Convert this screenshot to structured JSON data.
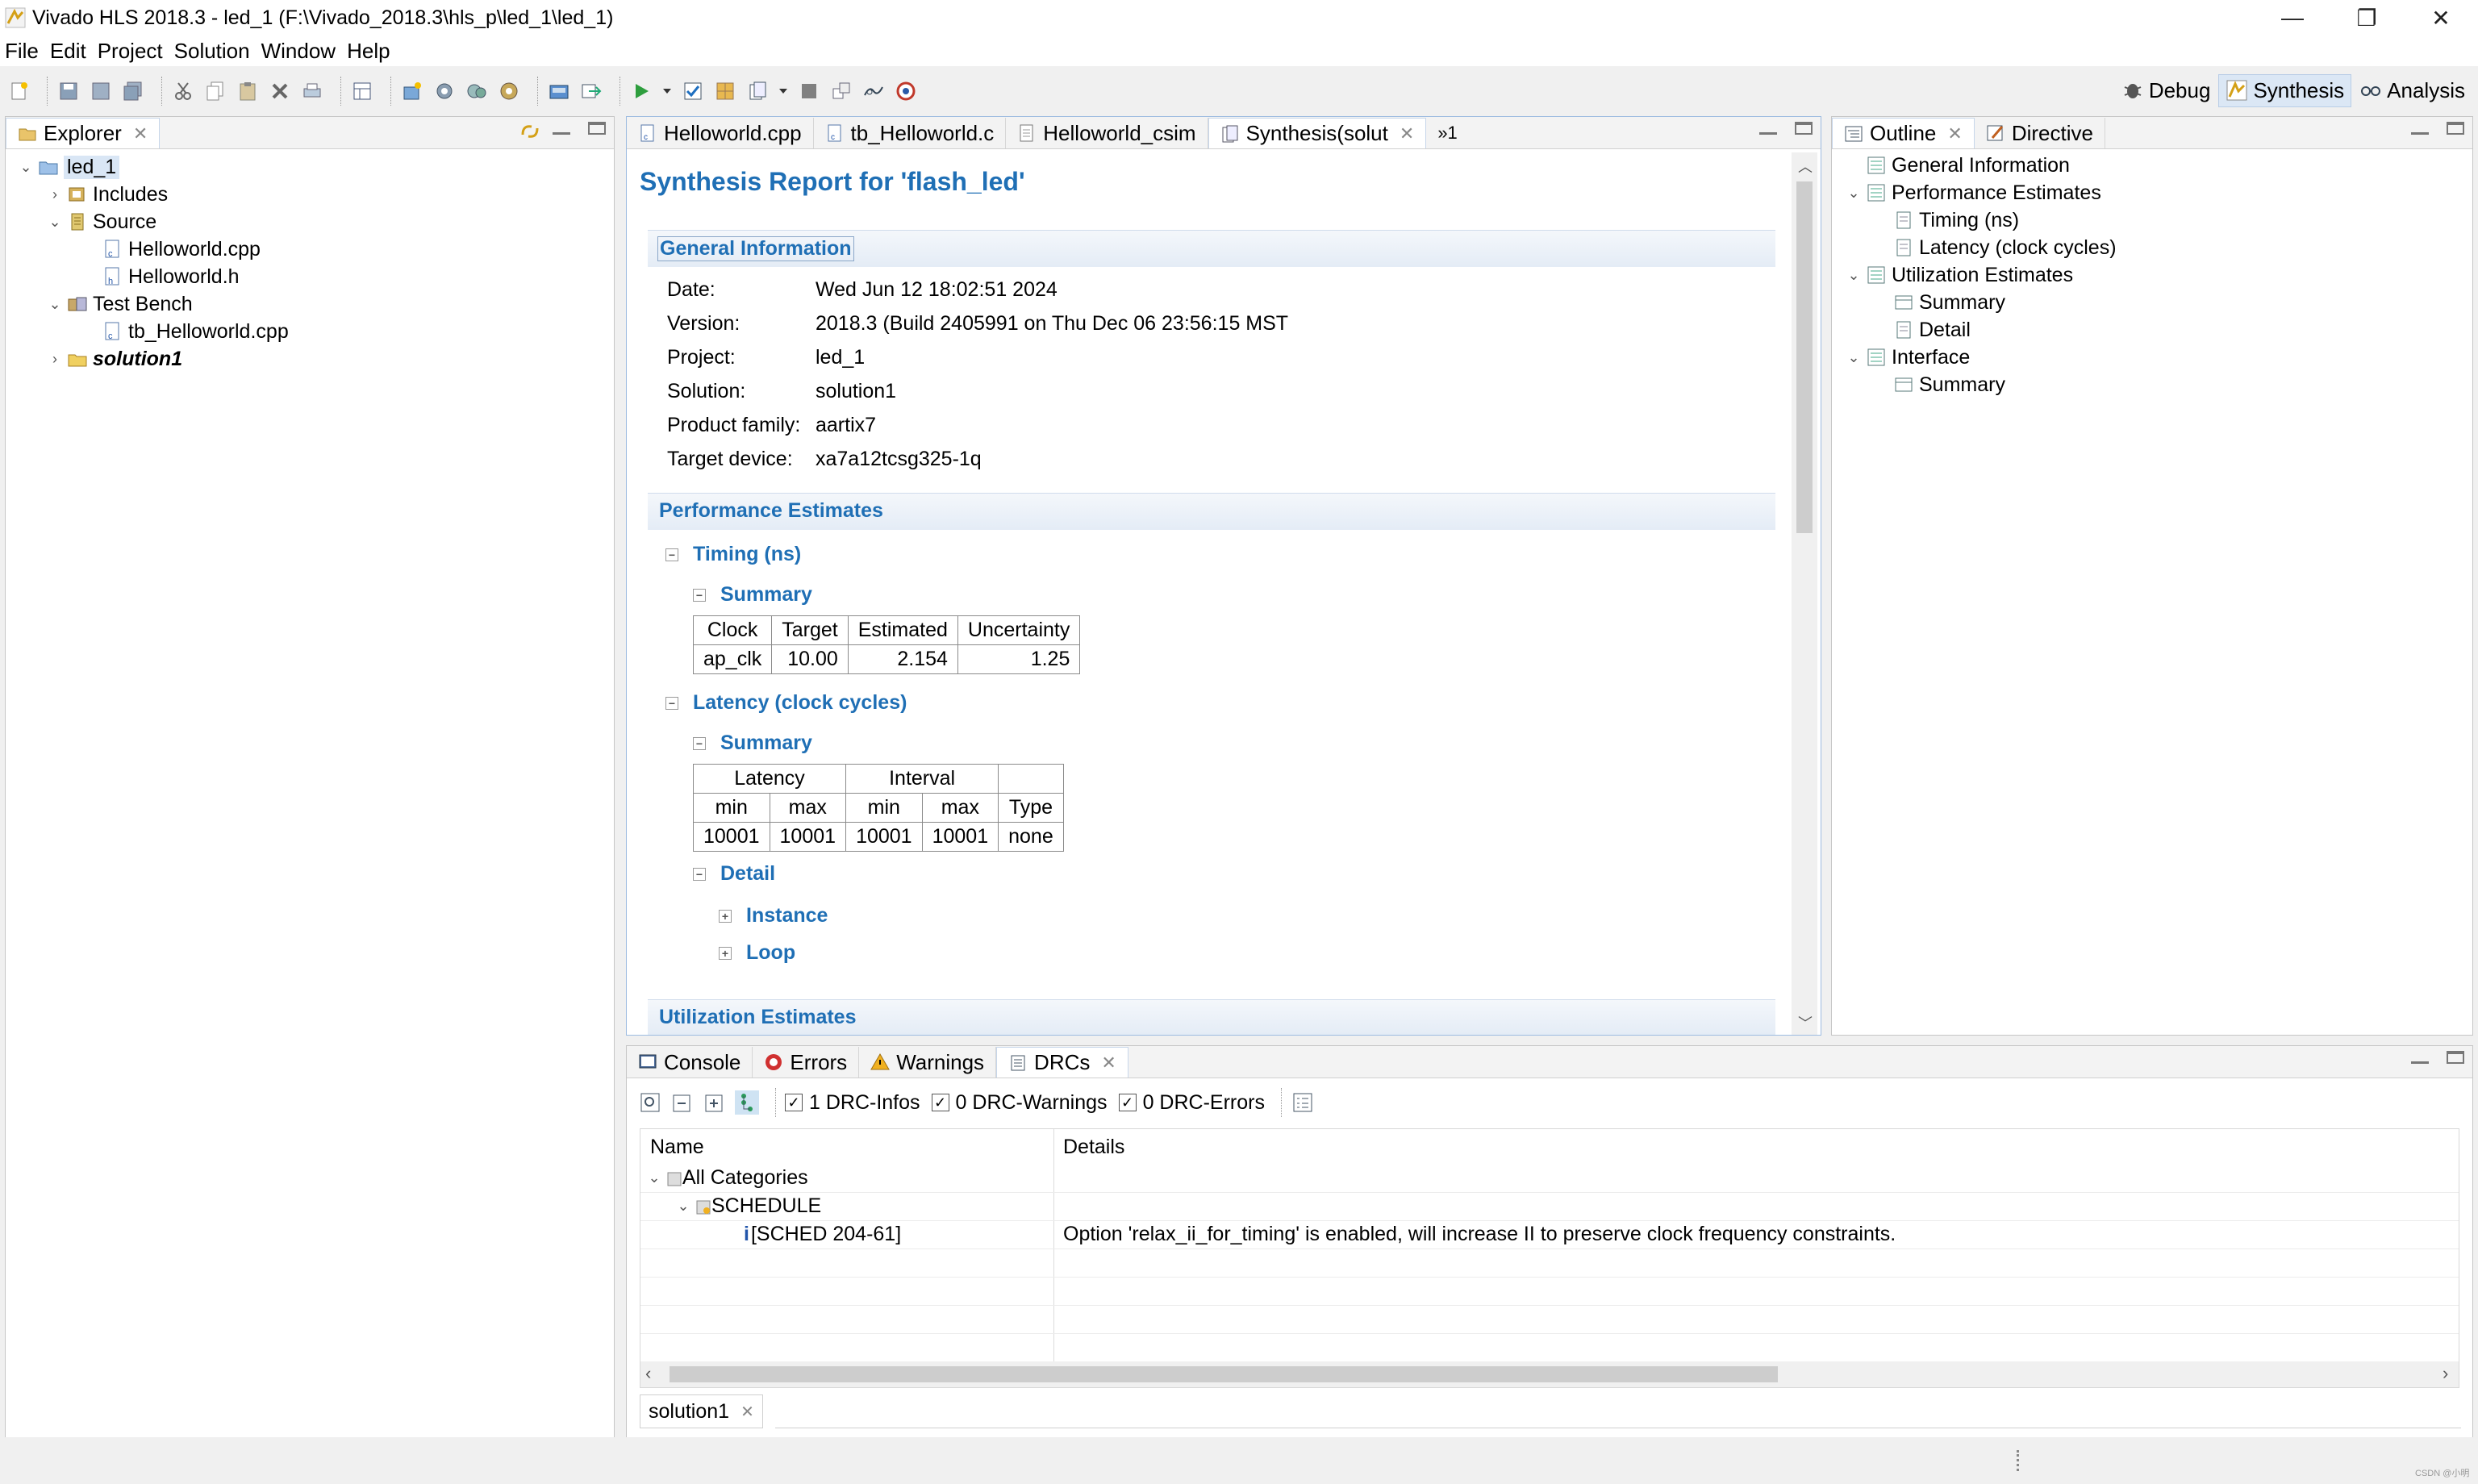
{
  "window": {
    "title": "Vivado HLS 2018.3 - led_1 (F:\\Vivado_2018.3\\hls_p\\led_1\\led_1)",
    "minimize_glyph": "—",
    "restore_glyph": "❐",
    "close_glyph": "✕"
  },
  "menu": [
    "File",
    "Edit",
    "Project",
    "Solution",
    "Window",
    "Help"
  ],
  "perspectives": [
    "Debug",
    "Synthesis",
    "Analysis"
  ],
  "explorer": {
    "tab": "Explorer",
    "tree": {
      "root": "led_1",
      "includes": "Includes",
      "source": "Source",
      "source_files": [
        "Helloworld.cpp",
        "Helloworld.h"
      ],
      "testbench": "Test Bench",
      "testbench_files": [
        "tb_Helloworld.cpp"
      ],
      "solution": "solution1"
    }
  },
  "editor": {
    "tabs": [
      "Helloworld.cpp",
      "tb_Helloworld.c",
      "Helloworld_csim",
      "Synthesis(solut"
    ],
    "overflow": "»1",
    "report": {
      "title": "Synthesis Report for 'flash_led'",
      "general": {
        "title": "General Information",
        "rows": [
          {
            "k": "Date:",
            "v": "Wed Jun 12 18:02:51 2024"
          },
          {
            "k": "Version:",
            "v": "2018.3 (Build 2405991 on Thu Dec 06 23:56:15 MST"
          },
          {
            "k": "Project:",
            "v": "led_1"
          },
          {
            "k": "Solution:",
            "v": "solution1"
          },
          {
            "k": "Product family:",
            "v": "aartix7"
          },
          {
            "k": "Target device:",
            "v": "xa7a12tcsg325-1q"
          }
        ]
      },
      "performance": {
        "title": "Performance Estimates",
        "timing": "Timing (ns)",
        "summary": "Summary",
        "timing_headers": [
          "Clock",
          "Target",
          "Estimated",
          "Uncertainty"
        ],
        "timing_row": [
          "ap_clk",
          "10.00",
          "2.154",
          "1.25"
        ],
        "latency": "Latency (clock cycles)",
        "latency_summary": "Summary",
        "latency_group_headers": [
          "Latency",
          "Interval"
        ],
        "latency_headers": [
          "min",
          "max",
          "min",
          "max",
          "Type"
        ],
        "latency_row": [
          "10001",
          "10001",
          "10001",
          "10001",
          "none"
        ],
        "detail": "Detail",
        "instance": "Instance",
        "loop": "Loop"
      },
      "utilization_title": "Utilization Estimates"
    }
  },
  "outline": {
    "tabs": [
      "Outline",
      "Directive"
    ],
    "items": [
      {
        "label": "General Information",
        "level": 0
      },
      {
        "label": "Performance Estimates",
        "level": 0
      },
      {
        "label": "Timing (ns)",
        "level": 1
      },
      {
        "label": "Latency (clock cycles)",
        "level": 1
      },
      {
        "label": "Utilization Estimates",
        "level": 0
      },
      {
        "label": "Summary",
        "level": 1
      },
      {
        "label": "Detail",
        "level": 1
      },
      {
        "label": "Interface",
        "level": 0
      },
      {
        "label": "Summary",
        "level": 1
      }
    ]
  },
  "bottom": {
    "tabs": [
      "Console",
      "Errors",
      "Warnings",
      "DRCs"
    ],
    "filters": [
      "1 DRC-Infos",
      "0 DRC-Warnings",
      "0 DRC-Errors"
    ],
    "columns": [
      "Name",
      "Details"
    ],
    "rows": [
      {
        "name": "All Categories",
        "details": ""
      },
      {
        "name": "SCHEDULE",
        "details": ""
      },
      {
        "name": "[SCHED 204-61]",
        "details": "Option 'relax_ii_for_timing' is enabled, will increase II to preserve clock frequency constraints."
      }
    ],
    "solution_tab": "solution1"
  },
  "watermark": "CSDN @小明",
  "colors": {
    "accent": "#1f6fb5",
    "active_tab_border": "#c7d6ea"
  }
}
